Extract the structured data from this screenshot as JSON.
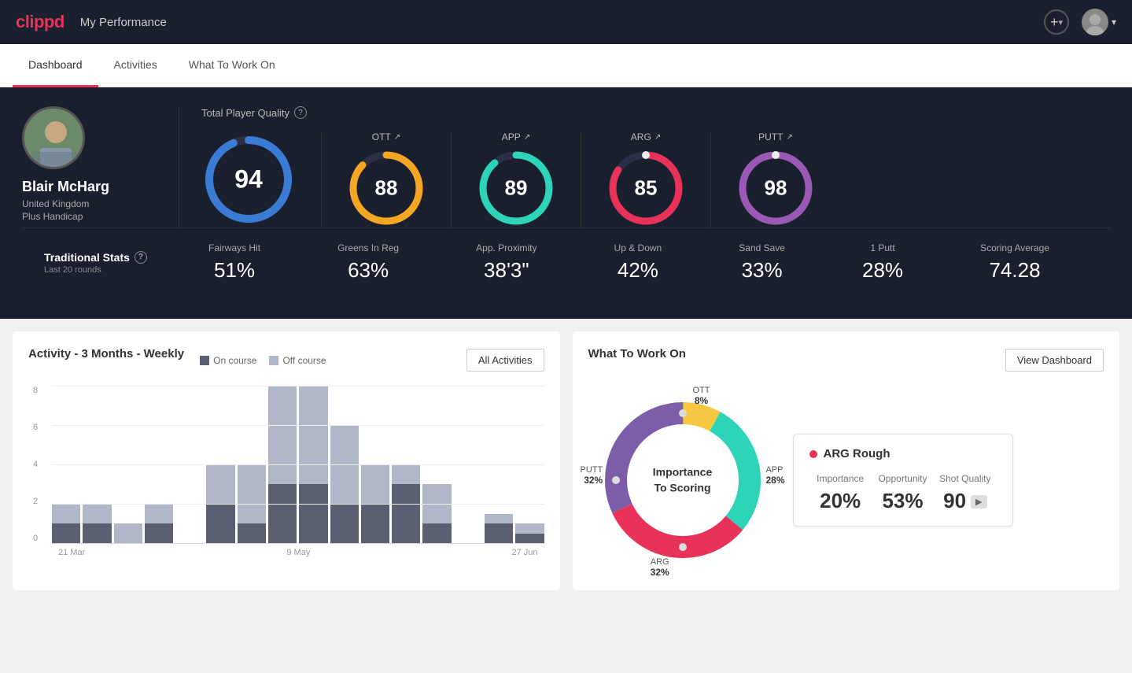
{
  "header": {
    "logo": "clippd",
    "title": "My Performance",
    "add_icon": "+",
    "chevron": "▾"
  },
  "tabs": [
    {
      "label": "Dashboard",
      "active": true
    },
    {
      "label": "Activities",
      "active": false
    },
    {
      "label": "What To Work On",
      "active": false
    }
  ],
  "player": {
    "name": "Blair McHarg",
    "country": "United Kingdom",
    "handicap": "Plus Handicap"
  },
  "total_player_quality": {
    "label": "Total Player Quality",
    "value": 94,
    "categories": [
      {
        "label": "OTT",
        "value": 88,
        "color": "#f5a623",
        "bg": "#333"
      },
      {
        "label": "APP",
        "value": 89,
        "color": "#2dd4b8",
        "bg": "#333"
      },
      {
        "label": "ARG",
        "value": 85,
        "color": "#e8325a",
        "bg": "#333"
      },
      {
        "label": "PUTT",
        "value": 98,
        "color": "#9b59b6",
        "bg": "#333"
      }
    ]
  },
  "traditional_stats": {
    "title": "Traditional Stats",
    "subtitle": "Last 20 rounds",
    "stats": [
      {
        "name": "Fairways Hit",
        "value": "51%"
      },
      {
        "name": "Greens In Reg",
        "value": "63%"
      },
      {
        "name": "App. Proximity",
        "value": "38'3\""
      },
      {
        "name": "Up & Down",
        "value": "42%"
      },
      {
        "name": "Sand Save",
        "value": "33%"
      },
      {
        "name": "1 Putt",
        "value": "28%"
      },
      {
        "name": "Scoring Average",
        "value": "74.28"
      }
    ]
  },
  "activity_chart": {
    "title": "Activity - 3 Months - Weekly",
    "legend": {
      "on_course": "On course",
      "off_course": "Off course"
    },
    "button": "All Activities",
    "y_labels": [
      "8",
      "6",
      "4",
      "2",
      "0"
    ],
    "x_labels": [
      "21 Mar",
      "9 May",
      "27 Jun"
    ],
    "bars": [
      {
        "on": 1,
        "off": 1
      },
      {
        "on": 1,
        "off": 1
      },
      {
        "on": 0,
        "off": 1
      },
      {
        "on": 1,
        "off": 1
      },
      {
        "on": 0,
        "off": 0
      },
      {
        "on": 2,
        "off": 2
      },
      {
        "on": 1,
        "off": 3
      },
      {
        "on": 3,
        "off": 5
      },
      {
        "on": 3,
        "off": 5
      },
      {
        "on": 2,
        "off": 4
      },
      {
        "on": 2,
        "off": 2
      },
      {
        "on": 3,
        "off": 1
      },
      {
        "on": 1,
        "off": 2
      },
      {
        "on": 0,
        "off": 0
      },
      {
        "on": 1,
        "off": 0.5
      },
      {
        "on": 0.5,
        "off": 0.5
      }
    ]
  },
  "what_to_work_on": {
    "title": "What To Work On",
    "button": "View Dashboard",
    "donut_center": "Importance\nTo Scoring",
    "segments": [
      {
        "label": "OTT",
        "pct": "8%",
        "color": "#f5c842"
      },
      {
        "label": "APP",
        "pct": "28%",
        "color": "#2dd4b8"
      },
      {
        "label": "ARG",
        "pct": "32%",
        "color": "#e8325a"
      },
      {
        "label": "PUTT",
        "pct": "32%",
        "color": "#7b5ea7"
      }
    ],
    "selected_card": {
      "title": "ARG Rough",
      "cols": [
        {
          "label": "Importance",
          "value": "20%"
        },
        {
          "label": "Opportunity",
          "value": "53%"
        },
        {
          "label": "Shot Quality",
          "value": "90",
          "badge": true
        }
      ]
    }
  }
}
